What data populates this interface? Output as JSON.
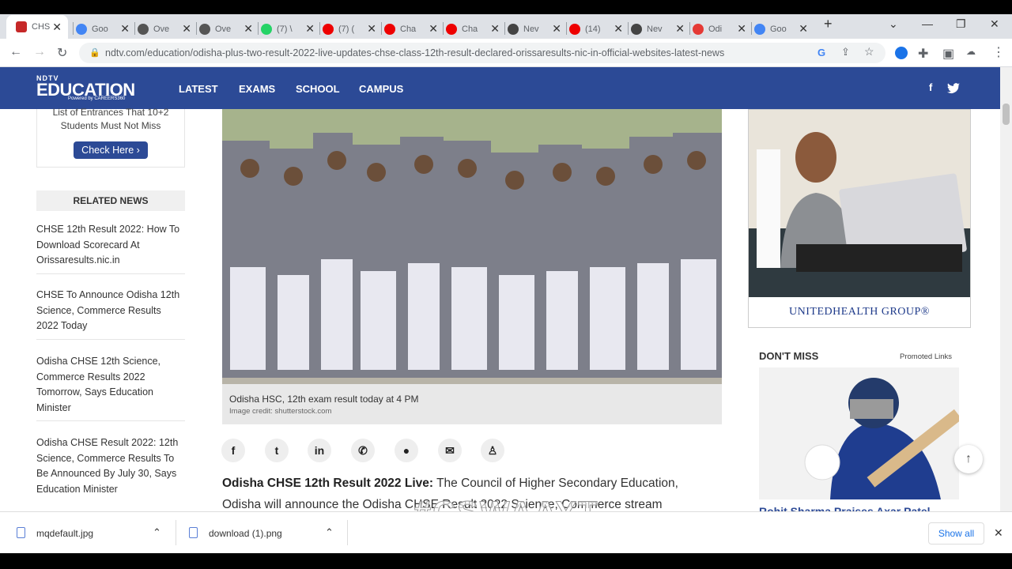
{
  "browser": {
    "tabs": [
      {
        "label": "CHS",
        "color": "#c62828"
      },
      {
        "label": "Goo",
        "color": "#4285f4"
      },
      {
        "label": "Ove",
        "color": "#555"
      },
      {
        "label": "Ove",
        "color": "#555"
      },
      {
        "label": "(7) \\",
        "color": "#25d366"
      },
      {
        "label": "(7) (",
        "color": "#e00"
      },
      {
        "label": "Cha",
        "color": "#e00"
      },
      {
        "label": "Cha",
        "color": "#e00"
      },
      {
        "label": "Nev",
        "color": "#444"
      },
      {
        "label": "(14)",
        "color": "#e00"
      },
      {
        "label": "Nev",
        "color": "#444"
      },
      {
        "label": "Odi",
        "color": "#e53935"
      },
      {
        "label": "Goo",
        "color": "#4285f4"
      }
    ],
    "url": "ndtv.com/education/odisha-plus-two-result-2022-live-updates-chse-class-12th-result-declared-orissaresults-nic-in-official-websites-latest-news"
  },
  "header": {
    "logo_top": "NDTV",
    "logo_main": "EDUCATION",
    "logo_sub": "Powered by CAREERS360",
    "menu": [
      "LATEST",
      "EXAMS",
      "SCHOOL",
      "CAMPUS"
    ]
  },
  "left": {
    "promo_text": "List of Entrances That 10+2 Students Must Not Miss",
    "check_label": "Check Here ›",
    "related_header": "RELATED NEWS",
    "related": [
      "CHSE 12th Result 2022: How To Download Scorecard At Orissaresults.nic.in",
      "CHSE To Announce Odisha 12th Science, Commerce Results 2022 Today",
      "Odisha CHSE 12th Science, Commerce Results 2022 Tomorrow, Says Education Minister",
      "Odisha CHSE Result 2022: 12th Science, Commerce Results To Be Announced By July 30, Says Education Minister"
    ]
  },
  "article": {
    "caption": "Odisha HSC, 12th exam result today at 4 PM",
    "credit": "Image credit: shutterstock.com",
    "lead_bold": "Odisha CHSE 12th Result 2022 Live:",
    "lead_text": " The Council of Higher Secondary Education, Odisha will announce the Odisha CHSE Result 2022 Science, Commerce stream"
  },
  "right": {
    "ad_brand": "UNITEDHEALTH GROUP®",
    "dont_miss": "DON'T MISS",
    "promoted": "Promoted Links",
    "dm_title": "Rohit Sharma Praises Axar Patel"
  },
  "downloads": {
    "items": [
      "mqdefault.jpg",
      "download (1).png"
    ],
    "show_all": "Show all"
  },
  "watermark": "#CSWAAYT"
}
